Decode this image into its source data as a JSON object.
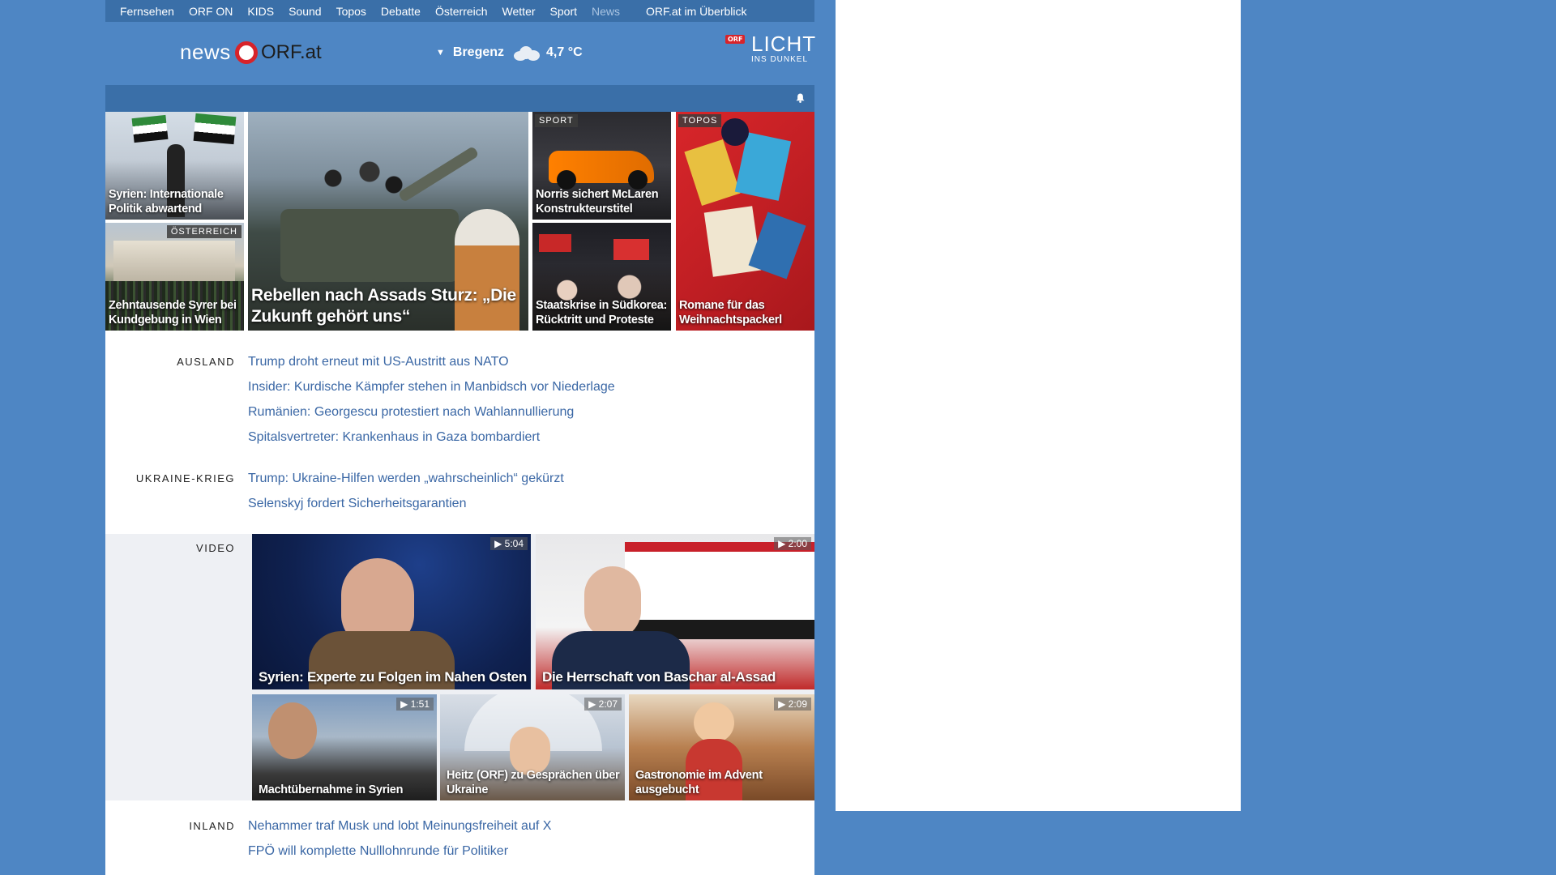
{
  "nav": {
    "items": [
      "Fernsehen",
      "ORF ON",
      "KIDS",
      "Sound",
      "Topos",
      "Debatte",
      "Österreich",
      "Wetter",
      "Sport",
      "News"
    ],
    "current": "News",
    "overview": "ORF.at im Überblick"
  },
  "header": {
    "logo_news": "news",
    "logo_orf": "ORF.at",
    "weather": {
      "city": "Bregenz",
      "temp": "4,7 °C",
      "icon": "cloud-icon"
    },
    "licht": {
      "badge": "ORF",
      "title": "LICHT",
      "subtitle": "INS DUNKEL"
    }
  },
  "teasers": {
    "syrien_politik": "Syrien: Internationale Politik abwartend",
    "kundgebung": {
      "tag": "ÖSTERREICH",
      "caption": "Zehntausende Syrer bei Kundgebung in Wien"
    },
    "rebellen": "Rebellen nach Assads Sturz: „Die Zukunft gehört uns“",
    "norris": {
      "tag": "SPORT",
      "caption": "Norris sichert McLaren Konstrukteurstitel"
    },
    "suedkorea": "Staatskrise in Südkorea: Rücktritt und Proteste",
    "romane": {
      "tag": "TOPOS",
      "caption": "Romane für das Weihnachtspackerl"
    }
  },
  "sections": {
    "ausland": {
      "label": "AUSLAND",
      "links": [
        "Trump droht erneut mit US-Austritt aus NATO",
        "Insider: Kurdische Kämpfer stehen in Manbidsch vor Niederlage",
        "Rumänien: Georgescu protestiert nach Wahlannullierung",
        "Spitalsvertreter: Krankenhaus in Gaza bombardiert"
      ]
    },
    "ukraine": {
      "label": "UKRAINE-KRIEG",
      "links": [
        "Trump: Ukraine-Hilfen werden „wahrscheinlich“ gekürzt",
        "Selenskyj fordert Sicherheitsgarantien"
      ]
    },
    "inland": {
      "label": "INLAND",
      "links": [
        "Nehammer traf Musk und lobt Meinungsfreiheit auf X",
        "FPÖ will komplette Nulllohnrunde für Politiker"
      ]
    }
  },
  "video": {
    "label": "VIDEO",
    "items": [
      {
        "caption": "Syrien: Experte zu Folgen im Nahen Osten",
        "duration": "5:04"
      },
      {
        "caption": "Die Herrschaft von Baschar al-Assad",
        "duration": "2:00"
      },
      {
        "caption": "Machtübernahme in Syrien",
        "duration": "1:51"
      },
      {
        "caption": "Heitz (ORF) zu Gesprächen über Ukraine",
        "duration": "2:07"
      },
      {
        "caption": "Gastronomie im Advent ausgebucht",
        "duration": "2:09"
      }
    ]
  }
}
